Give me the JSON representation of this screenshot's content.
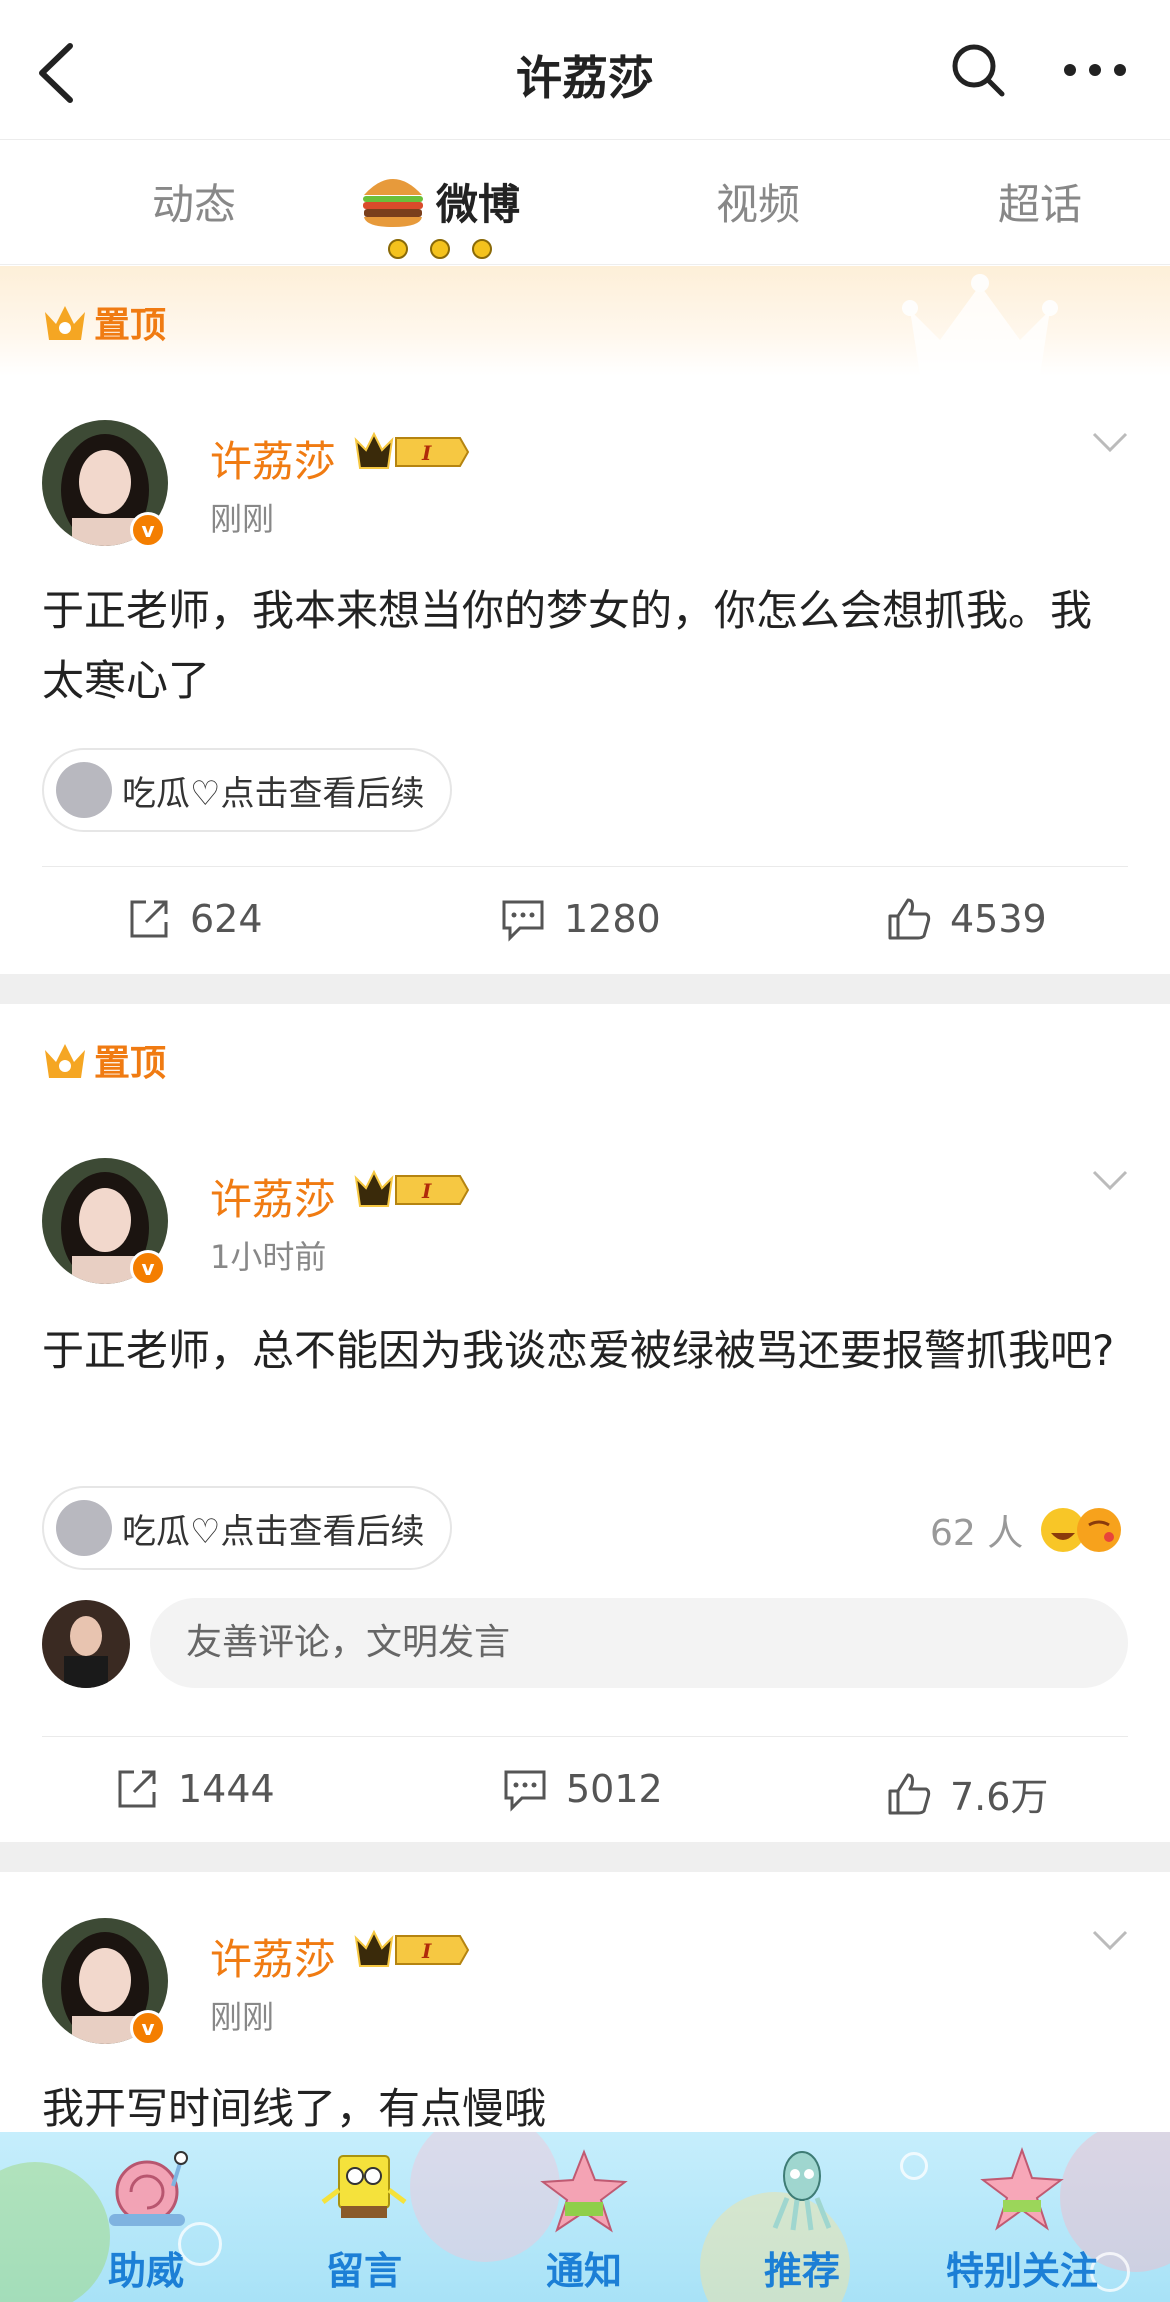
{
  "header": {
    "title": "许荔莎"
  },
  "tabs": [
    {
      "label": "动态",
      "active": false
    },
    {
      "label": "微博",
      "active": true
    },
    {
      "label": "视频",
      "active": false
    },
    {
      "label": "超话",
      "active": false
    }
  ],
  "pinned_label": "置顶",
  "posts": [
    {
      "author": "许荔莎",
      "level": "I",
      "time": "刚刚",
      "text": "于正老师，我本来想当你的梦女的，你怎么会想抓我。我太寒心了",
      "topic": "吃瓜♡点击查看后续",
      "reposts": "624",
      "comments": "1280",
      "likes": "4539"
    },
    {
      "author": "许荔莎",
      "level": "I",
      "time": "1小时前",
      "text": "于正老师，总不能因为我谈恋爱被绿被骂还要报警抓我吧?",
      "topic": "吃瓜♡点击查看后续",
      "reactions": "62 人",
      "comment_placeholder": "友善评论，文明发言",
      "reposts": "1444",
      "comments": "5012",
      "likes": "7.6万"
    },
    {
      "author": "许荔莎",
      "level": "I",
      "time": "刚刚",
      "text": "我开写时间线了，有点慢哦"
    }
  ],
  "bottom_nav": [
    {
      "label": "助威",
      "icon": "snail-icon"
    },
    {
      "label": "留言",
      "icon": "sponge-icon"
    },
    {
      "label": "通知",
      "icon": "starfish-icon"
    },
    {
      "label": "推荐",
      "icon": "squid-icon"
    },
    {
      "label": "特别关注",
      "icon": "pink-star-icon"
    }
  ],
  "colors": {
    "accent": "#f07b12",
    "link_blue": "#1c7fd6",
    "bottom_bg": "#b6e7fa"
  }
}
